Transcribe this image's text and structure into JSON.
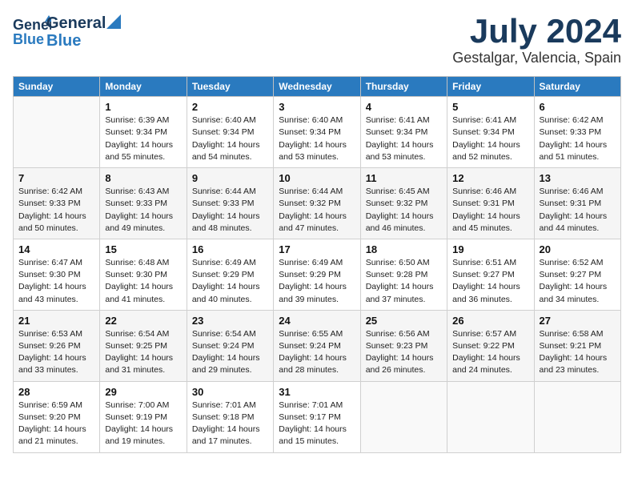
{
  "header": {
    "logo_line1": "General",
    "logo_line2": "Blue",
    "month": "July 2024",
    "location": "Gestalgar, Valencia, Spain"
  },
  "weekdays": [
    "Sunday",
    "Monday",
    "Tuesday",
    "Wednesday",
    "Thursday",
    "Friday",
    "Saturday"
  ],
  "weeks": [
    [
      {
        "day": "",
        "sunrise": "",
        "sunset": "",
        "daylight": ""
      },
      {
        "day": "1",
        "sunrise": "Sunrise: 6:39 AM",
        "sunset": "Sunset: 9:34 PM",
        "daylight": "Daylight: 14 hours and 55 minutes."
      },
      {
        "day": "2",
        "sunrise": "Sunrise: 6:40 AM",
        "sunset": "Sunset: 9:34 PM",
        "daylight": "Daylight: 14 hours and 54 minutes."
      },
      {
        "day": "3",
        "sunrise": "Sunrise: 6:40 AM",
        "sunset": "Sunset: 9:34 PM",
        "daylight": "Daylight: 14 hours and 53 minutes."
      },
      {
        "day": "4",
        "sunrise": "Sunrise: 6:41 AM",
        "sunset": "Sunset: 9:34 PM",
        "daylight": "Daylight: 14 hours and 53 minutes."
      },
      {
        "day": "5",
        "sunrise": "Sunrise: 6:41 AM",
        "sunset": "Sunset: 9:34 PM",
        "daylight": "Daylight: 14 hours and 52 minutes."
      },
      {
        "day": "6",
        "sunrise": "Sunrise: 6:42 AM",
        "sunset": "Sunset: 9:33 PM",
        "daylight": "Daylight: 14 hours and 51 minutes."
      }
    ],
    [
      {
        "day": "7",
        "sunrise": "Sunrise: 6:42 AM",
        "sunset": "Sunset: 9:33 PM",
        "daylight": "Daylight: 14 hours and 50 minutes."
      },
      {
        "day": "8",
        "sunrise": "Sunrise: 6:43 AM",
        "sunset": "Sunset: 9:33 PM",
        "daylight": "Daylight: 14 hours and 49 minutes."
      },
      {
        "day": "9",
        "sunrise": "Sunrise: 6:44 AM",
        "sunset": "Sunset: 9:33 PM",
        "daylight": "Daylight: 14 hours and 48 minutes."
      },
      {
        "day": "10",
        "sunrise": "Sunrise: 6:44 AM",
        "sunset": "Sunset: 9:32 PM",
        "daylight": "Daylight: 14 hours and 47 minutes."
      },
      {
        "day": "11",
        "sunrise": "Sunrise: 6:45 AM",
        "sunset": "Sunset: 9:32 PM",
        "daylight": "Daylight: 14 hours and 46 minutes."
      },
      {
        "day": "12",
        "sunrise": "Sunrise: 6:46 AM",
        "sunset": "Sunset: 9:31 PM",
        "daylight": "Daylight: 14 hours and 45 minutes."
      },
      {
        "day": "13",
        "sunrise": "Sunrise: 6:46 AM",
        "sunset": "Sunset: 9:31 PM",
        "daylight": "Daylight: 14 hours and 44 minutes."
      }
    ],
    [
      {
        "day": "14",
        "sunrise": "Sunrise: 6:47 AM",
        "sunset": "Sunset: 9:30 PM",
        "daylight": "Daylight: 14 hours and 43 minutes."
      },
      {
        "day": "15",
        "sunrise": "Sunrise: 6:48 AM",
        "sunset": "Sunset: 9:30 PM",
        "daylight": "Daylight: 14 hours and 41 minutes."
      },
      {
        "day": "16",
        "sunrise": "Sunrise: 6:49 AM",
        "sunset": "Sunset: 9:29 PM",
        "daylight": "Daylight: 14 hours and 40 minutes."
      },
      {
        "day": "17",
        "sunrise": "Sunrise: 6:49 AM",
        "sunset": "Sunset: 9:29 PM",
        "daylight": "Daylight: 14 hours and 39 minutes."
      },
      {
        "day": "18",
        "sunrise": "Sunrise: 6:50 AM",
        "sunset": "Sunset: 9:28 PM",
        "daylight": "Daylight: 14 hours and 37 minutes."
      },
      {
        "day": "19",
        "sunrise": "Sunrise: 6:51 AM",
        "sunset": "Sunset: 9:27 PM",
        "daylight": "Daylight: 14 hours and 36 minutes."
      },
      {
        "day": "20",
        "sunrise": "Sunrise: 6:52 AM",
        "sunset": "Sunset: 9:27 PM",
        "daylight": "Daylight: 14 hours and 34 minutes."
      }
    ],
    [
      {
        "day": "21",
        "sunrise": "Sunrise: 6:53 AM",
        "sunset": "Sunset: 9:26 PM",
        "daylight": "Daylight: 14 hours and 33 minutes."
      },
      {
        "day": "22",
        "sunrise": "Sunrise: 6:54 AM",
        "sunset": "Sunset: 9:25 PM",
        "daylight": "Daylight: 14 hours and 31 minutes."
      },
      {
        "day": "23",
        "sunrise": "Sunrise: 6:54 AM",
        "sunset": "Sunset: 9:24 PM",
        "daylight": "Daylight: 14 hours and 29 minutes."
      },
      {
        "day": "24",
        "sunrise": "Sunrise: 6:55 AM",
        "sunset": "Sunset: 9:24 PM",
        "daylight": "Daylight: 14 hours and 28 minutes."
      },
      {
        "day": "25",
        "sunrise": "Sunrise: 6:56 AM",
        "sunset": "Sunset: 9:23 PM",
        "daylight": "Daylight: 14 hours and 26 minutes."
      },
      {
        "day": "26",
        "sunrise": "Sunrise: 6:57 AM",
        "sunset": "Sunset: 9:22 PM",
        "daylight": "Daylight: 14 hours and 24 minutes."
      },
      {
        "day": "27",
        "sunrise": "Sunrise: 6:58 AM",
        "sunset": "Sunset: 9:21 PM",
        "daylight": "Daylight: 14 hours and 23 minutes."
      }
    ],
    [
      {
        "day": "28",
        "sunrise": "Sunrise: 6:59 AM",
        "sunset": "Sunset: 9:20 PM",
        "daylight": "Daylight: 14 hours and 21 minutes."
      },
      {
        "day": "29",
        "sunrise": "Sunrise: 7:00 AM",
        "sunset": "Sunset: 9:19 PM",
        "daylight": "Daylight: 14 hours and 19 minutes."
      },
      {
        "day": "30",
        "sunrise": "Sunrise: 7:01 AM",
        "sunset": "Sunset: 9:18 PM",
        "daylight": "Daylight: 14 hours and 17 minutes."
      },
      {
        "day": "31",
        "sunrise": "Sunrise: 7:01 AM",
        "sunset": "Sunset: 9:17 PM",
        "daylight": "Daylight: 14 hours and 15 minutes."
      },
      {
        "day": "",
        "sunrise": "",
        "sunset": "",
        "daylight": ""
      },
      {
        "day": "",
        "sunrise": "",
        "sunset": "",
        "daylight": ""
      },
      {
        "day": "",
        "sunrise": "",
        "sunset": "",
        "daylight": ""
      }
    ]
  ]
}
